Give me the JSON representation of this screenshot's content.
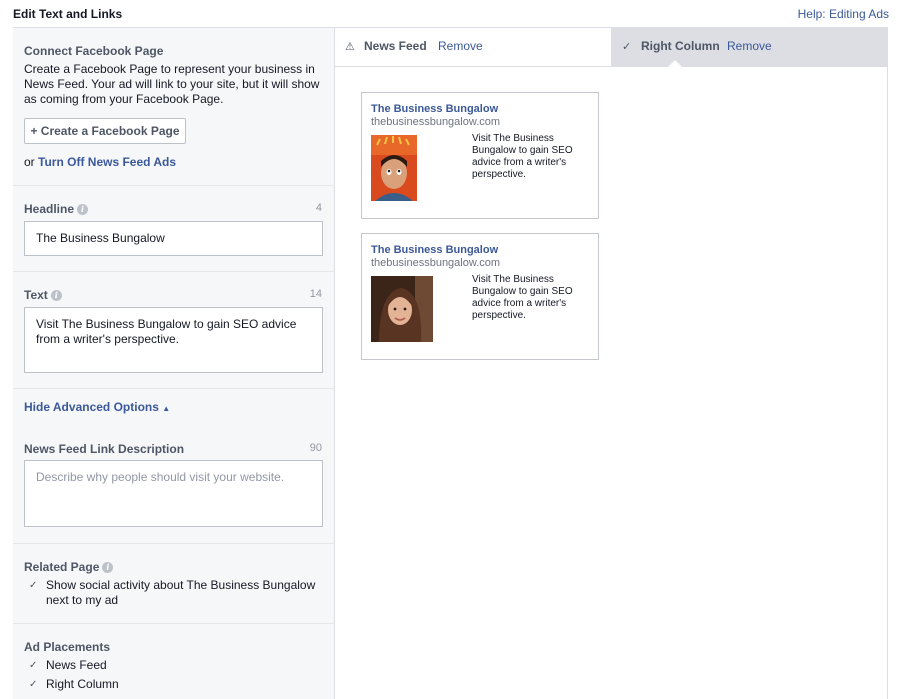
{
  "header": {
    "title": "Edit Text and Links",
    "help_link": "Help: Editing Ads"
  },
  "connect_page": {
    "title": "Connect Facebook Page",
    "description": "Create a Facebook Page to represent your business in News Feed. Your ad will link to your site, but it will show as coming from your Facebook Page.",
    "create_button": "+ Create a Facebook Page",
    "or_prefix": "or",
    "turn_off_link": "Turn Off News Feed Ads"
  },
  "headline": {
    "label": "Headline",
    "count": "4",
    "value": "The Business Bungalow"
  },
  "text": {
    "label": "Text",
    "count": "14",
    "value": "Visit The Business Bungalow to gain SEO advice from a writer's perspective."
  },
  "advanced": {
    "toggle_label": "Hide Advanced Options",
    "toggle_icon": "▲"
  },
  "link_description": {
    "label": "News Feed Link Description",
    "count": "90",
    "placeholder": "Describe why people should visit your website."
  },
  "related_page": {
    "label": "Related Page",
    "checkbox_label": "Show social activity about The Business Bungalow next to my ad"
  },
  "placements": {
    "label": "Ad Placements",
    "options": [
      "News Feed",
      "Right Column"
    ]
  },
  "tabs": [
    {
      "icon": "⚠",
      "name": "News Feed",
      "remove": "Remove",
      "active": false
    },
    {
      "icon": "✓",
      "name": "Right Column",
      "remove": "Remove",
      "active": true
    }
  ],
  "ads": [
    {
      "title": "The Business Bungalow",
      "url": "thebusinessbungalow.com",
      "text": "Visit The Business Bungalow to gain SEO advice from a writer's perspective.",
      "image": "man-photo"
    },
    {
      "title": "The Business Bungalow",
      "url": "thebusinessbungalow.com",
      "text": "Visit The Business Bungalow to gain SEO advice from a writer's perspective.",
      "image": "woman-photo"
    }
  ],
  "colors": {
    "link": "#3b5998",
    "sidebar_bg": "#f6f7f8",
    "active_tab_bg": "#dcdee3",
    "border": "#bdc1c9"
  }
}
